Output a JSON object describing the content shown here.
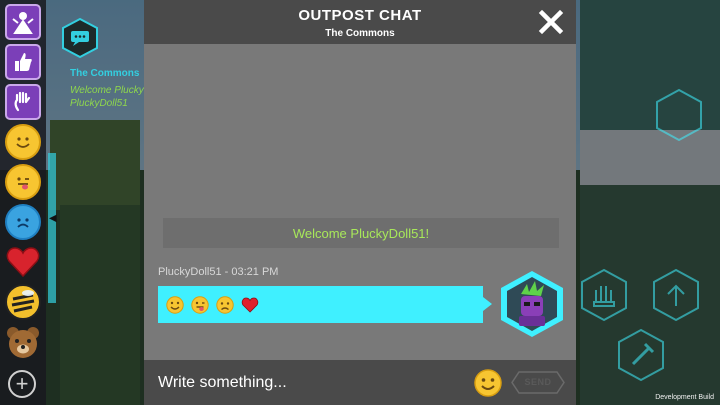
{
  "dialog": {
    "title": "OUTPOST CHAT",
    "subtitle": "The Commons",
    "close_icon": "close-x-icon"
  },
  "messages": {
    "system_welcome": "Welcome PluckyDoll51!",
    "sender_meta": "PluckyDoll51 - 03:21 PM",
    "emoji_icons": [
      "smile-emoji-icon",
      "tongue-out-emoji-icon",
      "worried-emoji-icon",
      "red-heart-icon"
    ]
  },
  "composer": {
    "placeholder": "Write something...",
    "send_label": "SEND",
    "emoji_icon": "smile-emoji-icon"
  },
  "side_panel": {
    "title": "The Commons",
    "line_1": "Welcome Plucky",
    "line_2": "PluckyDoll51"
  },
  "emote_bar": {
    "icons": [
      "emote-menu-icon",
      "thumbs-up-icon",
      "wave-hand-icon",
      "smile-emoji-icon",
      "tongue-out-emoji-icon",
      "sad-emoji-icon",
      "heart-icon",
      "bee-icon",
      "bear-icon",
      "add-icon"
    ]
  },
  "footer": {
    "build_label": "Development Build"
  },
  "colors": {
    "accent_cyan": "#3ff0ff",
    "welcome_green": "#a8e85a",
    "header_dark": "#4a4a4a",
    "panel_gray": "#797979"
  }
}
